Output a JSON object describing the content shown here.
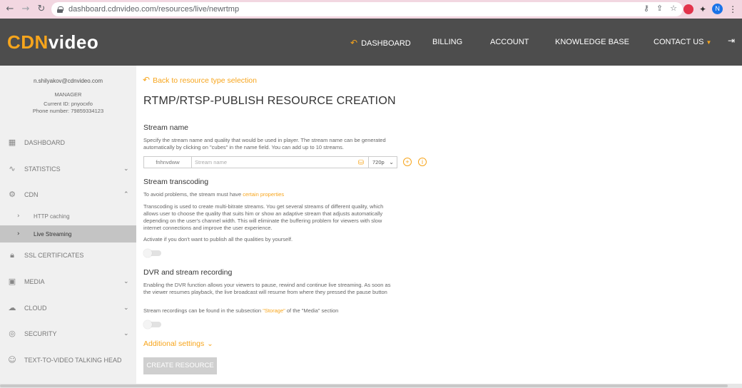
{
  "browser": {
    "url": "dashboard.cdnvideo.com/resources/live/newrtmp",
    "profile_initial": "N"
  },
  "header": {
    "logo_cdn": "CDN",
    "logo_video": "video",
    "nav": [
      {
        "label": "DASHBOARD"
      },
      {
        "label": "BILLING"
      },
      {
        "label": "ACCOUNT"
      },
      {
        "label": "KNOWLEDGE BASE"
      },
      {
        "label": "CONTACT US"
      }
    ]
  },
  "sidebar": {
    "email": "n.shilyakov@cdnvideo.com",
    "role": "MANAGER",
    "current_id": "Current ID: pnyocxfo",
    "phone": "Phone number: 79859334123",
    "items": [
      {
        "label": "DASHBOARD",
        "icon": "dashboard-icon"
      },
      {
        "label": "STATISTICS",
        "icon": "statistics-icon"
      },
      {
        "label": "CDN",
        "icon": "gear-icon"
      },
      {
        "label": "SSL CERTIFICATES",
        "icon": "lock-icon"
      },
      {
        "label": "MEDIA",
        "icon": "media-icon"
      },
      {
        "label": "CLOUD",
        "icon": "cloud-icon"
      },
      {
        "label": "SECURITY",
        "icon": "fingerprint-icon"
      },
      {
        "label": "TEXT-TO-VIDEO TALKING HEAD",
        "icon": "talking-head-icon"
      }
    ],
    "cdn_sub": [
      {
        "label": "HTTP caching"
      },
      {
        "label": "Live Streaming"
      }
    ]
  },
  "main": {
    "back_link": "Back to resource type selection",
    "title": "RTMP/RTSP-PUBLISH RESOURCE CREATION",
    "stream_name": {
      "heading": "Stream name",
      "desc": "Specify the stream name and quality that would be used in player. The stream name can be generated automatically by clicking on \"cubes\" in the name field. You can add up to 10 streams.",
      "id_value": "fnhnvdww",
      "placeholder": "Stream name",
      "quality": "720p"
    },
    "transcoding": {
      "heading": "Stream transcoding",
      "line1_prefix": "To avoid problems, the stream must have ",
      "line1_link": "certain properties",
      "desc": "Transcoding is used to create multi-bitrate streams. You get several streams of different quality, which allows user to choose the quality that suits him or show an adaptive stream that adjusts automatically depending on the user's channel width. This will eliminate the buffering problem for viewers with slow internet connections and improve the user experience.",
      "activate": "Activate if you don't want to publish all the qualities by yourself."
    },
    "dvr": {
      "heading": "DVR and stream recording",
      "desc": "Enabling the DVR function allows your viewers to pause, rewind and continue live streaming. As soon as the viewer resumes playback, the live broadcast will resume from where they pressed the pause button",
      "storage_prefix": "Stream recordings can be found in the subsection ",
      "storage_link": "\"Storage\"",
      "storage_suffix": " of the \"Media\" section"
    },
    "additional": "Additional settings",
    "create_button": "CREATE RESOURCE"
  },
  "colors": {
    "accent": "#f7a51c",
    "header_bg": "#4d4d4d",
    "sidebar_bg": "#f0f0f0"
  }
}
